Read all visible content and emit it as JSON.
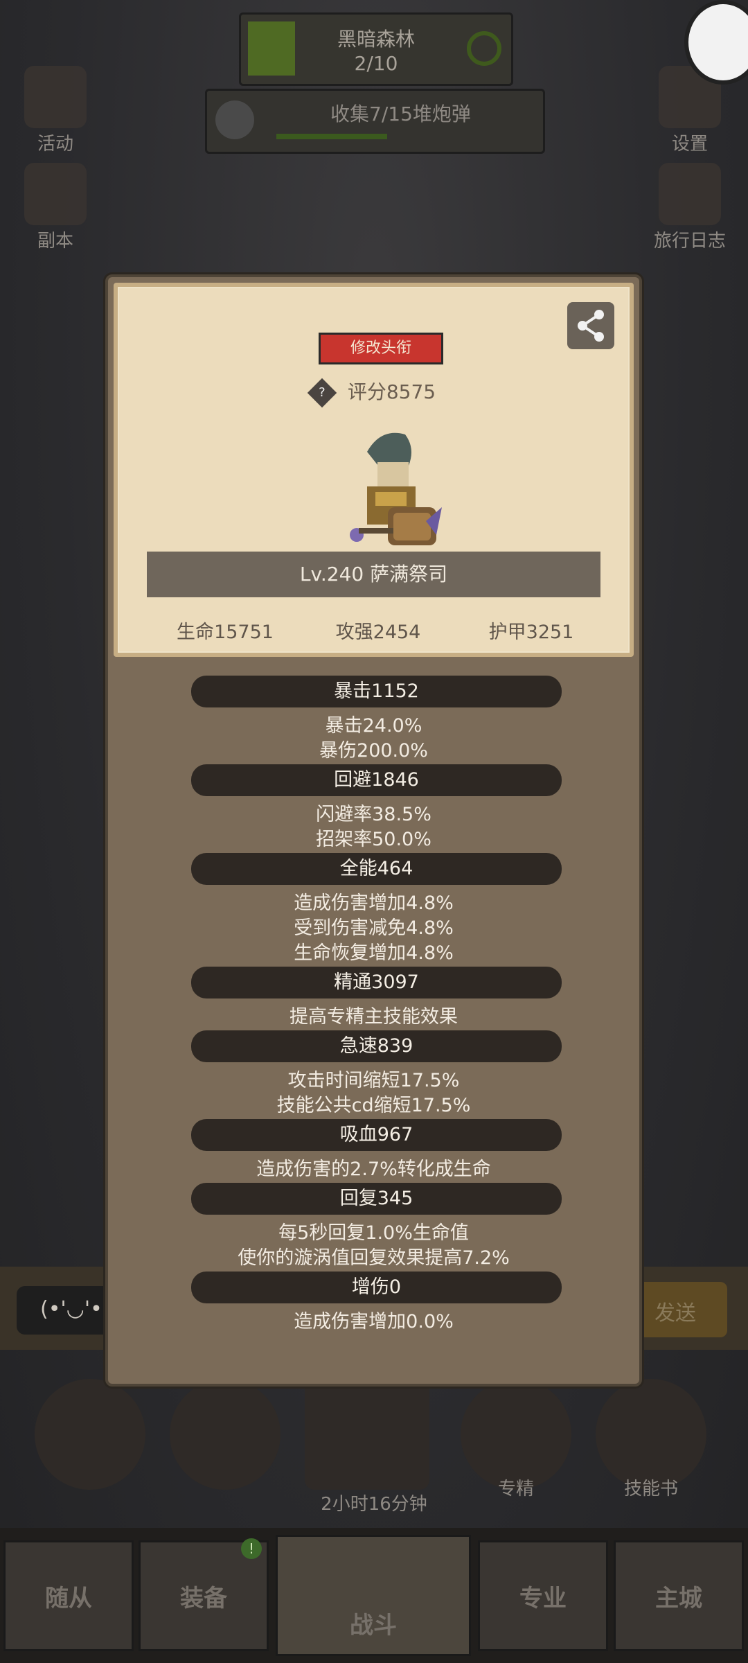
{
  "hud": {
    "stage_name": "黑暗森林",
    "stage_progress": "2/10",
    "quest_text": "收集7/15堆炮弹",
    "quest_progress": 0.47
  },
  "side_left": [
    {
      "label": "活动",
      "icon": "scroll-icon"
    },
    {
      "label": "副本",
      "icon": "portal-icon"
    }
  ],
  "side_right": [
    {
      "label": "设置",
      "icon": "gear-icon"
    },
    {
      "label": "旅行日志",
      "icon": "journal-icon"
    }
  ],
  "panel": {
    "title_button": "修改头衔",
    "score": "评分8575",
    "hero_name": "Lv.240 萨满祭司",
    "base_stats": [
      "生命15751",
      "攻强2454",
      "护甲3251"
    ]
  },
  "stats": [
    {
      "header": "暴击1152",
      "lines": [
        "暴击24.0%",
        "暴伤200.0%"
      ]
    },
    {
      "header": "回避1846",
      "lines": [
        "闪避率38.5%",
        "招架率50.0%"
      ]
    },
    {
      "header": "全能464",
      "lines": [
        "造成伤害增加4.8%",
        "受到伤害减免4.8%",
        "生命恢复增加4.8%"
      ]
    },
    {
      "header": "精通3097",
      "lines": [
        "提高专精主技能效果"
      ]
    },
    {
      "header": "急速839",
      "lines": [
        "攻击时间缩短17.5%",
        "技能公共cd缩短17.5%"
      ]
    },
    {
      "header": "吸血967",
      "lines": [
        "造成伤害的2.7%转化成生命"
      ]
    },
    {
      "header": "回复345",
      "lines": [
        "每5秒回复1.0%生命值",
        "使你的漩涡值回复效果提高7.2%"
      ]
    },
    {
      "header": "增伤0",
      "lines": [
        "造成伤害增加0.0%"
      ]
    }
  ],
  "chat": {
    "emoji": "(•'◡'•",
    "send_label": "发送"
  },
  "bottom": {
    "specialty_label": "专精",
    "skillbook_label": "技能书",
    "timer": "2小时16分钟"
  },
  "nav": {
    "tabs": [
      "随从",
      "装备",
      "战斗",
      "专业",
      "主城"
    ],
    "active": "战斗",
    "badge": "!"
  }
}
